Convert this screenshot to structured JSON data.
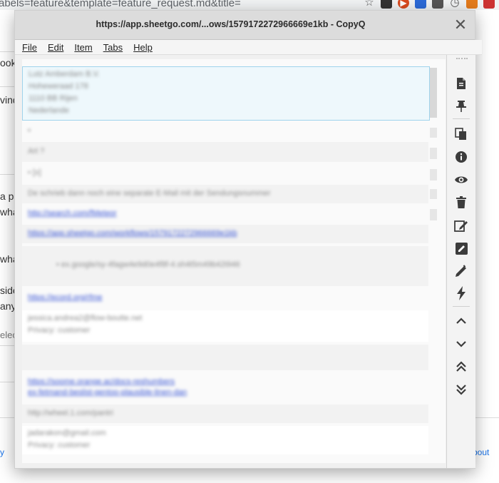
{
  "background_page": {
    "url_fragment": "abels=feature&template=feature_request.md&title=",
    "left_fragments": [
      "ook",
      "vind",
      "a p",
      "wha",
      "wha",
      "side",
      "any",
      "elec"
    ],
    "bottom_link_left": "y",
    "bottom_link_right": "bout"
  },
  "window": {
    "title": "https://app.sheetgo.com/...ows/1579172272966669e1kb - CopyQ",
    "close_icon": "close-icon",
    "menu": [
      "File",
      "Edit",
      "Item",
      "Tabs",
      "Help"
    ]
  },
  "clipboard_items": [
    {
      "lines": [
        "Lutz Amberdam B.V.",
        "Hoheweraad 178",
        "1110 BB Rijen",
        "Nederlande"
      ]
    },
    {
      "lines": [
        "•"
      ]
    },
    {
      "lines": [
        "Art ?"
      ]
    },
    {
      "lines": [
        "• [x]"
      ]
    },
    {
      "lines": [
        "De schrieb dann noch eine separate E-Mail mit der Sendungsnummer"
      ]
    },
    {
      "lines": [
        "http://search.com/fMeteor"
      ]
    },
    {
      "lines": [
        "https://app.sheetgo.com/workflows/1579172272966669e1kb"
      ]
    },
    {
      "lines": [
        "• ex.google/sy-4fagw4e9d0e4f8f-4.sh4t5m49b42t946"
      ]
    },
    {
      "lines": [
        "https://ecord.org/rfme"
      ]
    },
    {
      "lines": [
        "jessica.andrea2@flow-boutte.net",
        "Privacy: customer"
      ]
    },
    {
      "lines": [
        ""
      ]
    },
    {
      "lines": [
        "https://soome.orange.ac/docs-reshumbers",
        "ex-fetmand-beslist-gentoo-plausible-linen-dan"
      ]
    },
    {
      "lines": [
        "http://wheel.1.com/pantri"
      ]
    },
    {
      "lines": [
        "jadarakon@gmail.com",
        "Privacy: customer"
      ]
    }
  ],
  "toolbar": [
    "new-item-icon",
    "pin-icon",
    "copy-icon",
    "info-icon",
    "preview-eye-icon",
    "delete-icon",
    "edit-icon",
    "edit-notes-icon",
    "edit-external-icon",
    "action-lightning-icon",
    "move-up-icon",
    "move-down-icon",
    "move-to-top-icon",
    "move-to-bottom-icon"
  ]
}
